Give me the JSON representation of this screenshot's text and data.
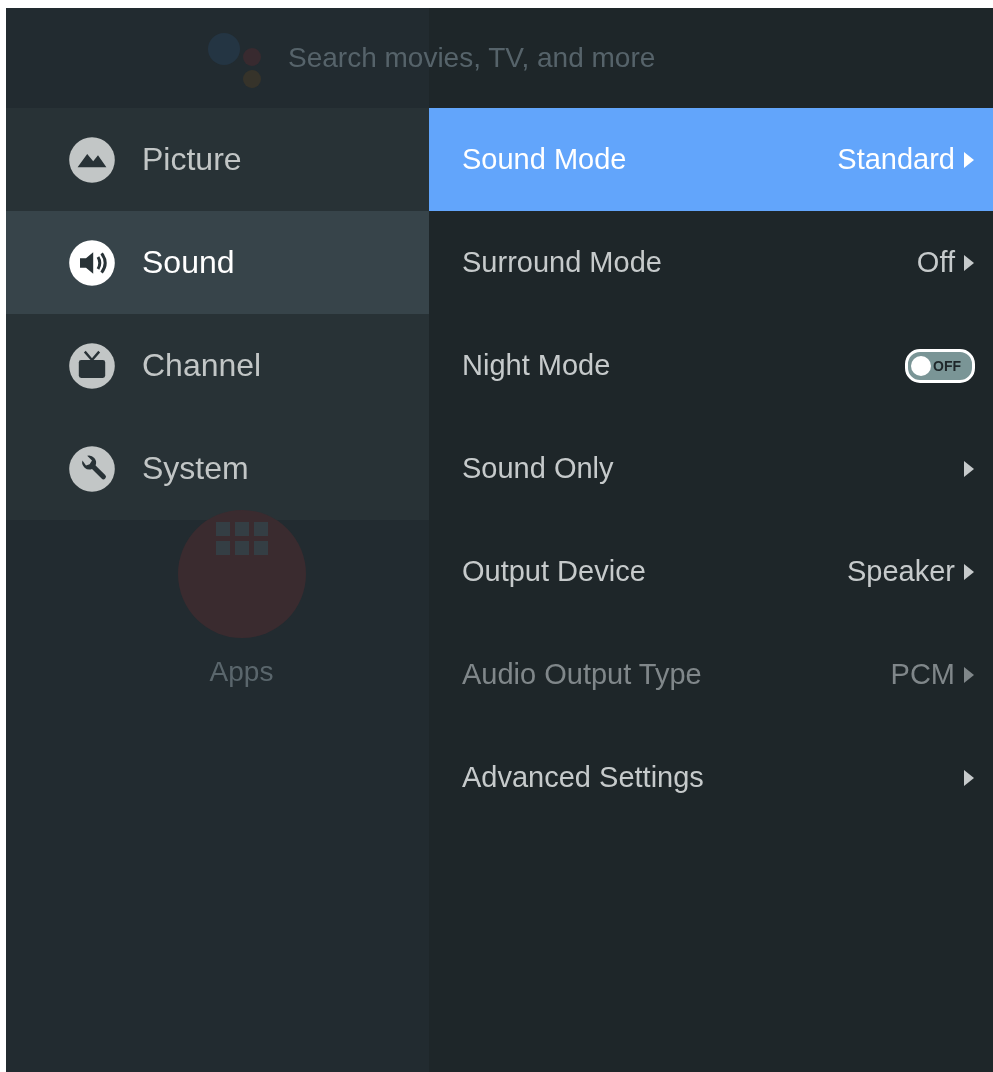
{
  "background": {
    "search_hint": "Search movies, TV, and more",
    "apps_label": "Apps"
  },
  "categories": [
    {
      "label": "Picture",
      "selected": false
    },
    {
      "label": "Sound",
      "selected": true
    },
    {
      "label": "Channel",
      "selected": false
    },
    {
      "label": "System",
      "selected": false
    }
  ],
  "settings": [
    {
      "kind": "submenu",
      "label": "Sound Mode",
      "value": "Standard",
      "selected": true,
      "disabled": false
    },
    {
      "kind": "submenu",
      "label": "Surround Mode",
      "value": "Off",
      "selected": false,
      "disabled": false
    },
    {
      "kind": "toggle",
      "label": "Night Mode",
      "on": false,
      "state_label": "OFF",
      "selected": false,
      "disabled": false
    },
    {
      "kind": "submenu",
      "label": "Sound Only",
      "selected": false,
      "disabled": false
    },
    {
      "kind": "submenu",
      "label": "Output Device",
      "value": "Speaker",
      "selected": false,
      "disabled": false
    },
    {
      "kind": "submenu",
      "label": "Audio Output Type",
      "value": "PCM",
      "selected": false,
      "disabled": true
    },
    {
      "kind": "submenu",
      "label": "Advanced Settings",
      "selected": false,
      "disabled": false
    }
  ]
}
